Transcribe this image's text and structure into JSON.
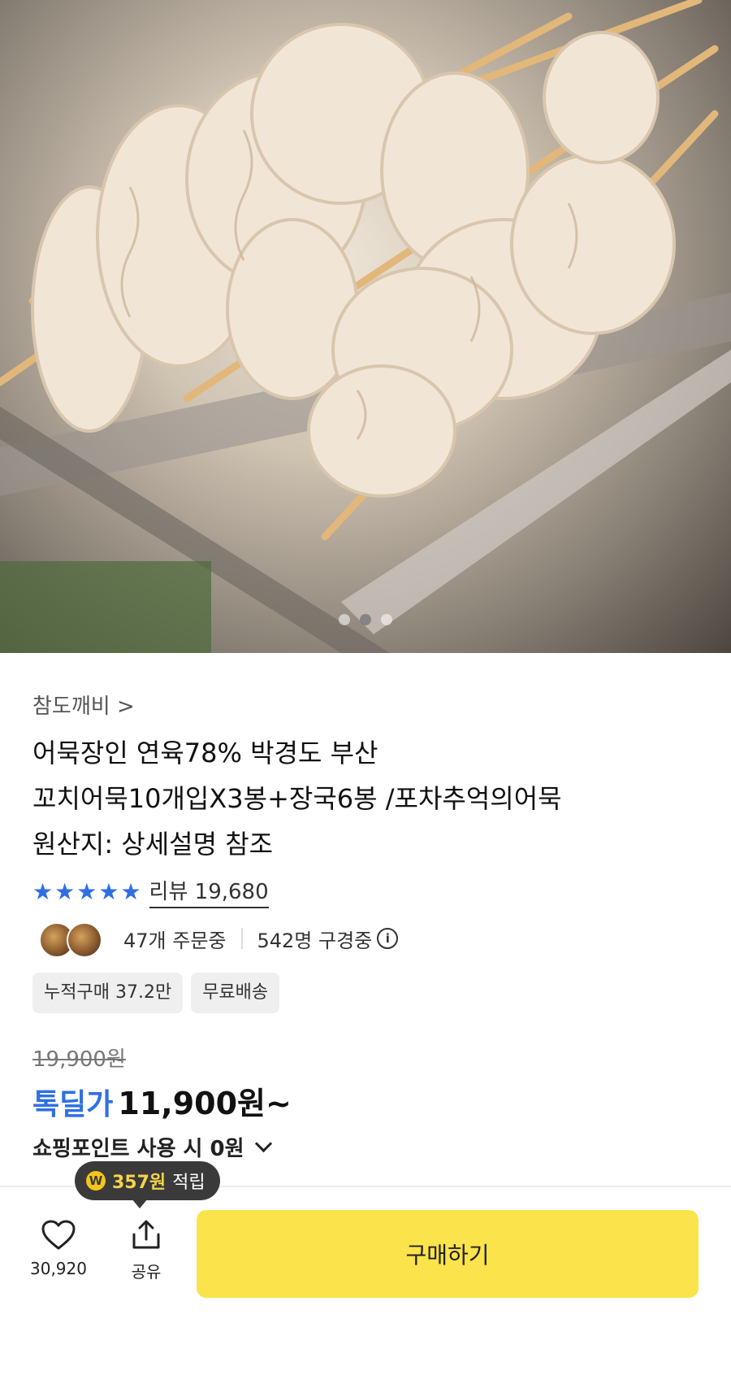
{
  "seller": {
    "name": "참도깨비 >"
  },
  "product": {
    "title_lines": [
      "어묵장인 연육78% 박경도 부산",
      "꼬치어묵10개입X3봉+장국6봉 /포차추억의어묵",
      "원산지: 상세설명 참조"
    ],
    "rating_stars": 5,
    "review_label": "리뷰 19,680",
    "orders": "47개 주문중",
    "viewers": "542명 구경중",
    "tags": [
      "누적구매 37.2만",
      "무료배송"
    ],
    "original_price": "19,900원",
    "deal_label": "톡딜가",
    "price": "11,900원~",
    "points": "쇼핑포인트 사용 시 0원"
  },
  "gallery": {
    "total": 3,
    "active": 2
  },
  "tooltip": {
    "amount": "357원",
    "label": "적립"
  },
  "bottom_bar": {
    "like_count": "30,920",
    "share_label": "공유",
    "buy_label": "구매하기"
  },
  "colors": {
    "accent": "#2f6fe4",
    "buy_button": "#fbe34b",
    "tooltip_bg": "#3a3a3a"
  },
  "icons": [
    "star-icon",
    "info-icon",
    "coin-icon",
    "heart-icon",
    "share-icon",
    "chevron-down-icon"
  ]
}
